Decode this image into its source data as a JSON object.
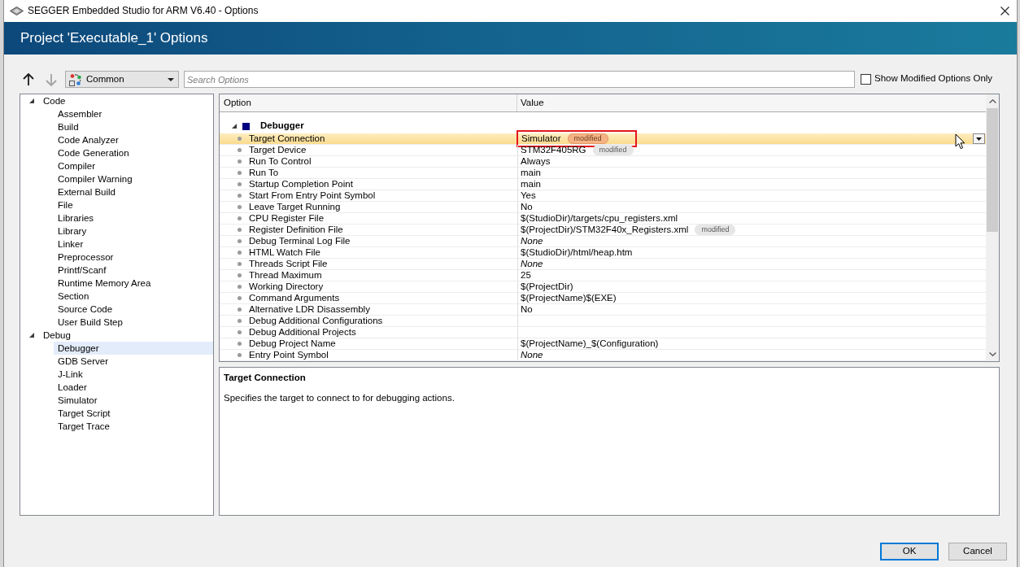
{
  "window": {
    "title": "SEGGER Embedded Studio for ARM V6.40 - Options"
  },
  "header": {
    "title": "Project 'Executable_1' Options"
  },
  "toolbar": {
    "arrows": [
      {
        "kind": "up",
        "disabled": false
      },
      {
        "kind": "down",
        "disabled": true
      }
    ],
    "configuration": "Common",
    "search": {
      "placeholder": "Search Options"
    },
    "modified_only": {
      "label": "Show Modified Options Only",
      "checked": false
    }
  },
  "tree": [
    {
      "label": "Code",
      "expanded": true,
      "selected": false,
      "children": [
        {
          "label": "Assembler",
          "selected": false
        },
        {
          "label": "Build",
          "selected": false
        },
        {
          "label": "Code Analyzer",
          "selected": false
        },
        {
          "label": "Code Generation",
          "selected": false
        },
        {
          "label": "Compiler",
          "selected": false
        },
        {
          "label": "Compiler Warning",
          "selected": false
        },
        {
          "label": "External Build",
          "selected": false
        },
        {
          "label": "File",
          "selected": false
        },
        {
          "label": "Libraries",
          "selected": false
        },
        {
          "label": "Library",
          "selected": false
        },
        {
          "label": "Linker",
          "selected": false
        },
        {
          "label": "Preprocessor",
          "selected": false
        },
        {
          "label": "Printf/Scanf",
          "selected": false
        },
        {
          "label": "Runtime Memory Area",
          "selected": false
        },
        {
          "label": "Section",
          "selected": false
        },
        {
          "label": "Source Code",
          "selected": false
        },
        {
          "label": "User Build Step",
          "selected": false
        }
      ]
    },
    {
      "label": "Debug",
      "expanded": true,
      "selected": false,
      "children": [
        {
          "label": "Debugger",
          "selected": true
        },
        {
          "label": "GDB Server",
          "selected": false
        },
        {
          "label": "J-Link",
          "selected": false
        },
        {
          "label": "Loader",
          "selected": false
        },
        {
          "label": "Simulator",
          "selected": false
        },
        {
          "label": "Target Script",
          "selected": false
        },
        {
          "label": "Target Trace",
          "selected": false
        }
      ]
    }
  ],
  "options_table": {
    "columns": [
      "Option",
      "Value"
    ],
    "groups": [
      {
        "label": "Debugger",
        "expanded": true,
        "rows": [
          {
            "option": "Target Connection",
            "value": "Simulator",
            "badge": "modified",
            "selected": true,
            "unset": false,
            "outlined": true
          },
          {
            "option": "Target Device",
            "value": "STM32F405RG",
            "badge": "modified",
            "selected": false,
            "unset": false,
            "outlined": false
          },
          {
            "option": "Run To Control",
            "value": "Always",
            "selected": false,
            "unset": false,
            "outlined": false
          },
          {
            "option": "Run To",
            "value": "main",
            "selected": false,
            "unset": false,
            "outlined": false
          },
          {
            "option": "Startup Completion Point",
            "value": "main",
            "selected": false,
            "unset": false,
            "outlined": false
          },
          {
            "option": "Start From Entry Point Symbol",
            "value": "Yes",
            "selected": false,
            "unset": false,
            "outlined": false
          },
          {
            "option": "Leave Target Running",
            "value": "No",
            "selected": false,
            "unset": false,
            "outlined": false
          },
          {
            "option": "CPU Register File",
            "value": "$(StudioDir)/targets/cpu_registers.xml",
            "selected": false,
            "unset": false,
            "outlined": false
          },
          {
            "option": "Register Definition File",
            "value": "$(ProjectDir)/STM32F40x_Registers.xml",
            "badge": "modified",
            "selected": false,
            "unset": false,
            "outlined": false
          },
          {
            "option": "Debug Terminal Log File",
            "value": "None",
            "selected": false,
            "unset": true,
            "outlined": false
          },
          {
            "option": "HTML Watch File",
            "value": "$(StudioDir)/html/heap.htm",
            "selected": false,
            "unset": false,
            "outlined": false
          },
          {
            "option": "Threads Script File",
            "value": "None",
            "selected": false,
            "unset": true,
            "outlined": false
          },
          {
            "option": "Thread Maximum",
            "value": "25",
            "selected": false,
            "unset": false,
            "outlined": false
          },
          {
            "option": "Working Directory",
            "value": "$(ProjectDir)",
            "selected": false,
            "unset": false,
            "outlined": false
          },
          {
            "option": "Command Arguments",
            "value": "$(ProjectName)$(EXE)",
            "selected": false,
            "unset": false,
            "outlined": false
          },
          {
            "option": "Alternative LDR Disassembly",
            "value": "No",
            "selected": false,
            "unset": false,
            "outlined": false
          },
          {
            "option": "Debug Additional Configurations",
            "selected": false,
            "outlined": false
          },
          {
            "option": "Debug Additional Projects",
            "selected": false,
            "outlined": false
          },
          {
            "option": "Debug Project Name",
            "value": "$(ProjectName)_$(Configuration)",
            "selected": false,
            "unset": false,
            "outlined": false
          },
          {
            "option": "Entry Point Symbol",
            "value": "None",
            "selected": false,
            "unset": true,
            "outlined": false
          }
        ]
      }
    ]
  },
  "description": {
    "title": "Target Connection",
    "text": "Specifies the target to connect to for debugging actions."
  },
  "buttons": [
    {
      "label": "OK",
      "default": true
    },
    {
      "label": "Cancel",
      "default": false
    }
  ]
}
